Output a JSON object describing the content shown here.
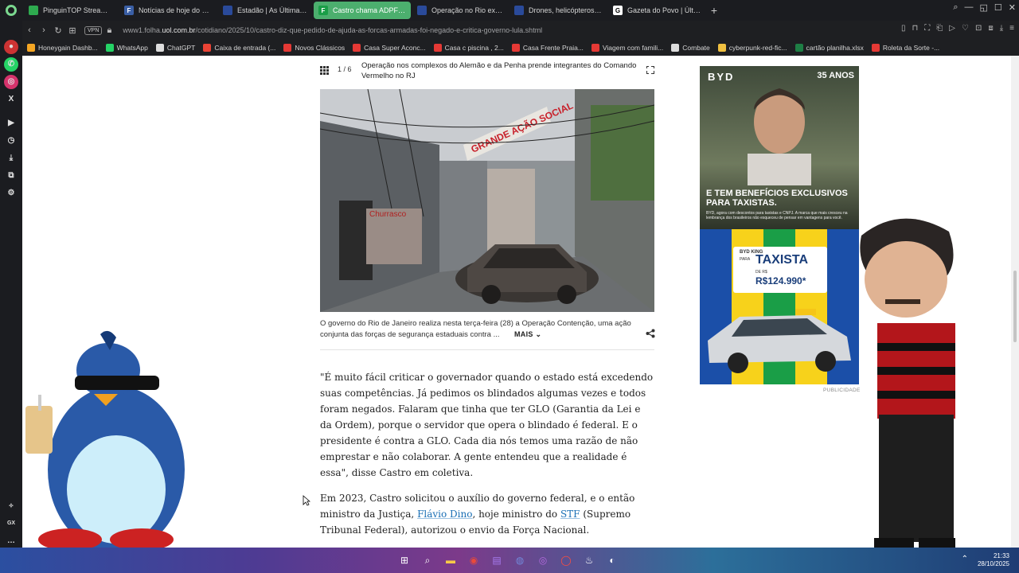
{
  "tabs": [
    {
      "title": "PinguinTOP Stream - Wa",
      "color": "#2eaa4f",
      "glyph": "",
      "active": false
    },
    {
      "title": "Notícias de hoje do Brasil",
      "color": "#3a5fa6",
      "glyph": "F",
      "active": false
    },
    {
      "title": "Estadão | As Últimas Not",
      "color": "#2a4a9a",
      "glyph": "",
      "active": false
    },
    {
      "title": "Castro chama ADPF de \"",
      "color": "#1a9e47",
      "glyph": "F",
      "active": true
    },
    {
      "title": "Operação no Rio expõe",
      "color": "#2a4a9a",
      "glyph": "",
      "active": false
    },
    {
      "title": "Drones, helicópteros e do",
      "color": "#2a4a9a",
      "glyph": "",
      "active": false
    },
    {
      "title": "Gazeta do Povo | Últimas",
      "color": "#ffffff",
      "glyph": "G",
      "active": false
    }
  ],
  "address_bar": {
    "vpn_label": "VPN",
    "url_host": "www1.folha.",
    "url_domain": "uol.com.br",
    "url_path": "/cotidiano/2025/10/castro-diz-que-pedido-de-ajuda-as-forcas-armadas-foi-negado-e-critica-governo-lula.shtml"
  },
  "bookmarks": [
    {
      "label": "Honeygain Dashb...",
      "color": "#f5a623"
    },
    {
      "label": "WhatsApp",
      "color": "#25d366"
    },
    {
      "label": "ChatGPT",
      "color": "#dddddd"
    },
    {
      "label": "Caixa de entrada (...",
      "color": "#ea4335"
    },
    {
      "label": "Novos Clássicos",
      "color": "#e53935"
    },
    {
      "label": "Casa Super Aconc...",
      "color": "#e53935"
    },
    {
      "label": "Casa c piscina , 2...",
      "color": "#e53935"
    },
    {
      "label": "Casa Frente Praia...",
      "color": "#e53935"
    },
    {
      "label": "Viagem com famili...",
      "color": "#e53935"
    },
    {
      "label": "Combate",
      "color": "#dddddd"
    },
    {
      "label": "cyberpunk-red-fic...",
      "color": "#f0c040"
    },
    {
      "label": "cartão planilha.xlsx",
      "color": "#1e7e45"
    },
    {
      "label": "Roleta da Sorte -...",
      "color": "#e53935"
    }
  ],
  "gallery": {
    "counter": "1 / 6",
    "title": "Operação nos complexos do Alemão e da Penha prende integrantes do Comando Vermelho no RJ",
    "caption": "O governo do Rio de Janeiro realiza nesta terça-feira (28) a Operação Contenção, uma ação conjunta das forças de segurança estaduais contra ...",
    "more_label": "MAIS",
    "photo_banner": "GRANDE AÇÃO SOCIAL",
    "photo_sign": "Churrasco"
  },
  "article": {
    "p1": "\"É muito fácil criticar o governador quando o estado está excedendo suas competências. Já pedimos os blindados algumas vezes e todos foram negados. Falaram que tinha que ter GLO (Garantia da Lei e da Ordem), porque o servidor que opera o blindado é federal. E o presidente é contra a GLO. Cada dia nós temos uma razão de não emprestar e não colaborar. A gente entendeu que a realidade é essa\", disse Castro em coletiva.",
    "p2_a": "Em 2023, Castro solicitou o auxílio do governo federal, e o então ministro da Justiça, ",
    "p2_link1": "Flávio Dino",
    "p2_b": ", hoje ministro do ",
    "p2_link2": "STF",
    "p2_c": " (Supremo Tribunal Federal), autorizou o envio da Força Nacional."
  },
  "ad": {
    "brand": "BYD",
    "badge": "35 ANOS",
    "headline": "E TEM BENEFÍCIOS EXCLUSIVOS PARA TAXISTAS.",
    "small_text": "BYD, agora com descontos para taxistas e CNPJ. A marca que mais cresceu na lembrança dos brasileiros não esqueceu de pensar em vantagens para você.",
    "model": "BYD KING",
    "model_sub": "PARA",
    "taxi_label": "TAXISTA",
    "price_prefix": "DE R$",
    "price": "R$124.990*",
    "label": "PUBLICIDADE"
  },
  "taskbar": {
    "time": "21:33",
    "date": "28/10/2025"
  }
}
